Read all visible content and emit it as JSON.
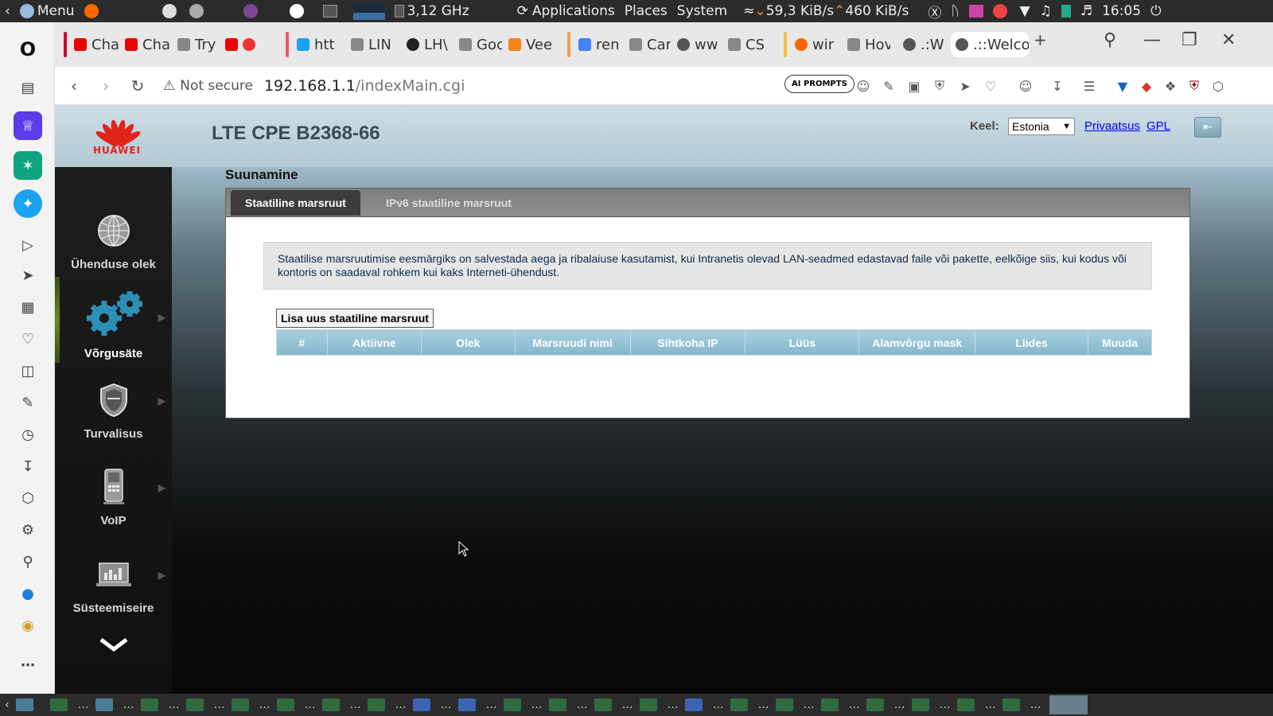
{
  "system_panel": {
    "menu_label": "Menu",
    "cpu_freq": "3,12 GHz",
    "applications_label": "Applications",
    "places_label": "Places",
    "system_label": "System",
    "net_down": "59,3 KiB/s",
    "net_up": "460 KiB/s",
    "clock": "16:05"
  },
  "tabs": [
    {
      "label": "Cha",
      "color": "#e00"
    },
    {
      "label": "Cha",
      "color": "#e00"
    },
    {
      "label": "Try",
      "color": "#888"
    },
    {
      "label": "",
      "color": "#e00"
    },
    {
      "label": "htt",
      "color": "#1da1f2"
    },
    {
      "label": "LIN",
      "color": "#888"
    },
    {
      "label": "LH\\",
      "color": "#222"
    },
    {
      "label": "Goc",
      "color": "#888"
    },
    {
      "label": "Vee",
      "color": "#f5841f"
    },
    {
      "label": "ren",
      "color": "#4285f4"
    },
    {
      "label": "Car",
      "color": "#888"
    },
    {
      "label": "ww",
      "color": "#555"
    },
    {
      "label": "CS",
      "color": "#888"
    },
    {
      "label": "wir",
      "color": "#f60"
    },
    {
      "label": "Hov",
      "color": "#888"
    },
    {
      "label": ".:W",
      "color": "#555"
    },
    {
      "label": ".::Welco",
      "color": "#555"
    }
  ],
  "address_bar": {
    "security_label": "Not secure",
    "url_host": "192.168.1.1",
    "url_path": "/indexMain.cgi",
    "ai_prompts_label": "AI PROMPTS"
  },
  "router": {
    "brand": "HUAWEI",
    "product": "LTE CPE B2368-66",
    "language_label": "Keel:",
    "language_value": "Estonia",
    "privacy_link": "Privaatsus",
    "gpl_link": "GPL",
    "menu": [
      {
        "label": "Ühenduse olek",
        "icon": "globe-icon"
      },
      {
        "label": "Võrgusäte",
        "icon": "gears-icon"
      },
      {
        "label": "Turvalisus",
        "icon": "shield-icon"
      },
      {
        "label": "VoIP",
        "icon": "phone-icon"
      },
      {
        "label": "Süsteemiseire",
        "icon": "monitor-icon"
      }
    ],
    "section_title": "Suunamine",
    "tabs": [
      "Staatiline marsruut",
      "IPv6 staatiline marsruut"
    ],
    "info_text": "Staatilise marsruutimise eesmärgiks on salvestada aega ja ribalaiuse kasutamist, kui Intranetis olevad LAN-seadmed edastavad faile või pakette, eelkõige siis, kui kodus või kontoris on saadaval rohkem kui kaks Interneti-ühendust.",
    "add_button": "Lisa uus staatiline marsruut",
    "table_columns": [
      "#",
      "Aktiivne",
      "Olek",
      "Marsruudi nimi",
      "Sihtkoha IP",
      "Lüüs",
      "Alamvõrgu mask",
      "Liides",
      "Muuda"
    ]
  },
  "colors": {
    "huawei_red": "#e2231a",
    "table_header": "#94c0d3",
    "active_tab": "#3c3c3c"
  }
}
